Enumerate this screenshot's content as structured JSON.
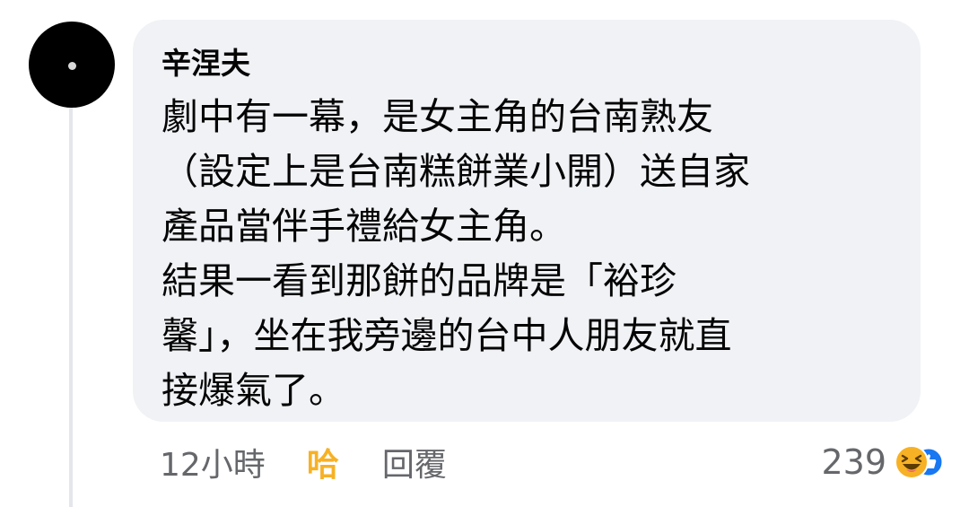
{
  "comment": {
    "author": "辛涅夫",
    "lines": [
      "劇中有一幕，是女主角的台南熟友",
      "（設定上是台南糕餅業小開）送自家",
      "產品當伴手禮給女主角。",
      "結果一看到那餅的品牌是「裕珍",
      "馨」，坐在我旁邊的台中人朋友就直",
      "接爆氣了。"
    ]
  },
  "actions": {
    "time": "12小時",
    "reaction_label": "哈",
    "reply_label": "回覆"
  },
  "reactions": {
    "count": "239",
    "icons": [
      "haha-icon",
      "like-icon"
    ]
  },
  "colors": {
    "bubble": "#f0f2f5",
    "haha": "#f7b125",
    "like": "#1877f2",
    "secondary_text": "#65676b"
  }
}
